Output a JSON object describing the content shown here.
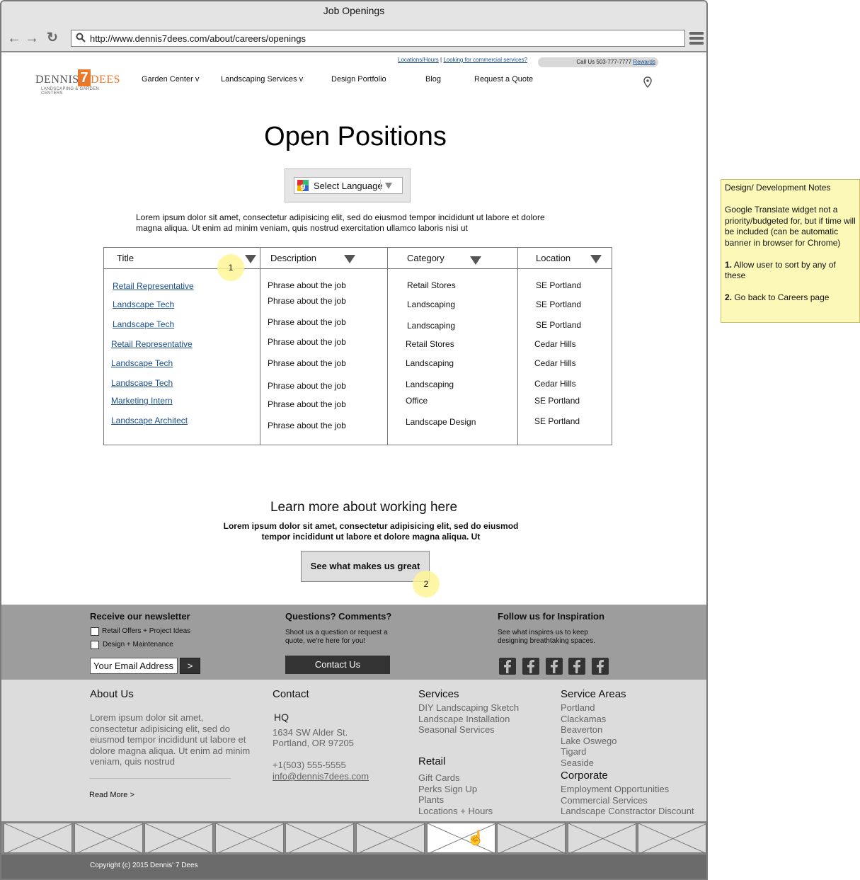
{
  "window": {
    "title": "Job Openings"
  },
  "browser": {
    "url": "http://www.dennis7dees.com/about/careers/openings"
  },
  "header": {
    "toplinks": [
      "Locations/Hours",
      "Looking for commercial services?"
    ],
    "callus": "Call Us 503-777-7777",
    "rewards": "Rewards",
    "logo": {
      "word1": "DENNIS'",
      "seven": "7",
      "word2": "DEES",
      "tagline": "LANDSCAPING & GARDEN CENTERS"
    },
    "nav": [
      "Garden Center v",
      "Landscaping Services v",
      "Design Portfolio",
      "Blog",
      "Request a Quote"
    ]
  },
  "page": {
    "title": "Open Positions",
    "language_label": "Select Language",
    "intro": "Lorem ipsum dolor sit amet, consectetur adipisicing elit, sed do eiusmod tempor incididunt ut labore et dolore magna aliqua. Ut enim ad minim veniam, quis nostrud exercitation ullamco laboris nisi ut"
  },
  "table": {
    "headers": [
      "Title",
      "Description",
      "Category",
      "Location"
    ],
    "rows": [
      {
        "title": "Retail Representative",
        "desc": "Phrase about the job",
        "category": "Retail Stores",
        "location": "SE Portland"
      },
      {
        "title": "Landscape Tech",
        "desc": "Phrase about the job",
        "category": "Landscaping",
        "location": "SE Portland"
      },
      {
        "title": "Landscape Tech",
        "desc": "Phrase about the job",
        "category": "Landscaping",
        "location": "SE Portland"
      },
      {
        "title": "Retail Representative",
        "desc": "Phrase about the job",
        "category": "Retail Stores",
        "location": "Cedar Hills"
      },
      {
        "title": "Landscape Tech",
        "desc": "Phrase about the job",
        "category": "Landscaping",
        "location": "Cedar Hills"
      },
      {
        "title": "Landscape Tech",
        "desc": "Phrase about the job",
        "category": "Landscaping",
        "location": "Cedar Hills"
      },
      {
        "title": "Marketing Intern",
        "desc": "Phrase about the job",
        "category": "Office",
        "location": "SE Portland"
      },
      {
        "title": "Landscape Architect",
        "desc": "Phrase about the job",
        "category": "Landscape Design",
        "location": "SE Portland"
      }
    ]
  },
  "callouts": [
    "1",
    "2"
  ],
  "learn": {
    "heading": "Learn more about working here",
    "text": "Lorem ipsum dolor sit amet, consectetur adipisicing elit, sed do eiusmod tempor incididunt ut labore et dolore magna aliqua. Ut",
    "button": "See what makes us great"
  },
  "footer_top": {
    "newsletter": {
      "heading": "Receive our newsletter",
      "options": [
        "Retail Offers + Project Ideas",
        "Design + Maintenance"
      ],
      "email_placeholder": "Your Email Address",
      "submit": ">"
    },
    "questions": {
      "heading": "Questions? Comments?",
      "text": "Shoot us a question or request a quote, we're here for you!",
      "button": "Contact Us"
    },
    "follow": {
      "heading": "Follow us for Inspiration",
      "text": "See what inspires us to keep designing breathtaking spaces."
    }
  },
  "footer_bottom": {
    "about": {
      "heading": "About Us",
      "text": "Lorem ipsum dolor sit amet, consectetur adipisicing elit, sed do eiusmod tempor incididunt ut labore et dolore magna aliqua. Ut enim ad minim veniam, quis nostrud",
      "readmore": "Read More >"
    },
    "contact": {
      "heading": "Contact",
      "hq": "HQ",
      "address1": "1634 SW Alder St.",
      "address2": "Portland, OR 97205",
      "phone": "+1(503) 555-5555",
      "email": "info@dennis7dees.com"
    },
    "services": {
      "heading": "Services",
      "items": [
        "DIY Landscaping Sketch",
        "Landscape Installation",
        "Seasonal Services"
      ]
    },
    "retail": {
      "heading": "Retail",
      "items": [
        "Gift Cards",
        "Perks Sign Up",
        "Plants",
        "Locations + Hours"
      ]
    },
    "areas": {
      "heading": "Service Areas",
      "items": [
        "Portland",
        "Clackamas",
        "Beaverton",
        "Lake Oswego",
        "Tigard",
        "Seaside"
      ]
    },
    "corporate": {
      "heading": "Corporate",
      "items": [
        "Employment Opportunities",
        "Commercial Services",
        "Landscape Constractor Discount"
      ]
    }
  },
  "copyright": "Copyright (c) 2015 Dennis' 7 Dees",
  "notes": {
    "heading": "Design/ Development Notes",
    "p1": "Google Translate widget not a priority/budgeted for, but if time will be included (can be automatic banner in browser for Chrome)",
    "n1_num": "1.",
    "n1": " Allow user to sort by any of these",
    "n2_num": "2.",
    "n2": " Go back to Careers page"
  },
  "colors": {
    "accent": "#e8782a",
    "link": "#1a4f8a",
    "note": "#fcf8b8",
    "footer_dark": "#6b6b6b"
  }
}
